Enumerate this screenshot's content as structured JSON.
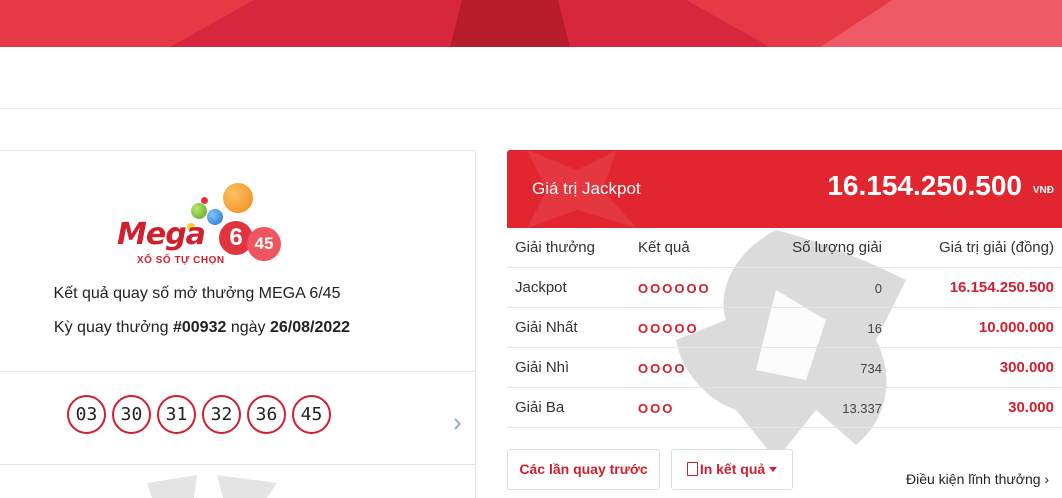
{
  "logo": {
    "word": "Mega",
    "six": "6",
    "fortyfive": "45",
    "tagline": "XỔ SỐ TỰ CHỌN"
  },
  "result": {
    "title": "Kết quả quay số mở thưởng MEGA 6/45",
    "draw_prefix": "Kỳ quay thưởng",
    "draw_number": "#00932",
    "date_prefix": "ngày",
    "date": "26/08/2022",
    "numbers": [
      "03",
      "30",
      "31",
      "32",
      "36",
      "45"
    ],
    "next_arrow": "›"
  },
  "jackpot": {
    "label": "Giá trị Jackpot",
    "value": "16.154.250.500",
    "unit": "VNĐ"
  },
  "prize_table": {
    "headers": [
      "Giải thưởng",
      "Kết quả",
      "Số lượng giải",
      "Giá trị giải (đồng)"
    ],
    "rows": [
      {
        "name": "Jackpot",
        "match": "OOOOOO",
        "count": "0",
        "value": "16.154.250.500"
      },
      {
        "name": "Giải Nhất",
        "match": "OOOOO",
        "count": "16",
        "value": "10.000.000"
      },
      {
        "name": "Giải Nhì",
        "match": "OOOO",
        "count": "734",
        "value": "300.000"
      },
      {
        "name": "Giải Ba",
        "match": "OOO",
        "count": "13.337",
        "value": "30.000"
      }
    ]
  },
  "actions": {
    "prev_draws": "Các lần quay trước",
    "print_results": "In kết quả",
    "conditions": "Điều kiện lĩnh thưởng ›"
  },
  "colors": {
    "brand_red": "#e2262f",
    "accent_red": "#d11f2e"
  }
}
